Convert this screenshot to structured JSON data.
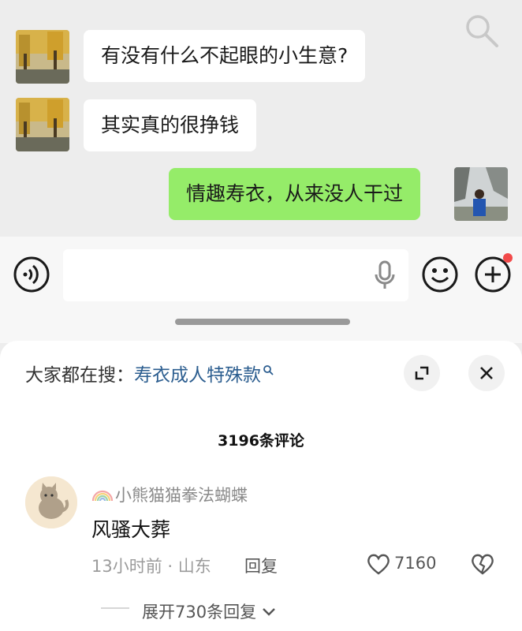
{
  "chat": {
    "messages": [
      {
        "side": "left",
        "text": "有没有什么不起眼的小生意?"
      },
      {
        "side": "left",
        "text": "其实真的很挣钱"
      },
      {
        "side": "right",
        "text": "情趣寿衣，从来没人干过"
      }
    ]
  },
  "icons": {
    "search": "search-icon",
    "voice": "voice-icon",
    "mic": "microphone-icon",
    "emoji": "emoji-icon",
    "plus": "plus-icon",
    "expand": "expand-icon",
    "close": "close-icon",
    "heart": "heart-icon",
    "broken_heart": "broken-heart-icon"
  },
  "colors": {
    "chat_bg": "#ededed",
    "incoming_bubble": "#ffffff",
    "outgoing_bubble": "#95ec69",
    "notification_dot": "#f24a4a",
    "search_keyword": "#2b5d8f"
  },
  "comment_sheet": {
    "trending_prefix": "大家都在搜：",
    "trending_keyword": "寿衣成人特殊款",
    "comment_count_title": "3196条评论",
    "comment": {
      "username": "小熊猫猫拳法蝴蝶",
      "text": "风骚大葬",
      "time_location": "13小时前 · 山东",
      "reply_label": "回复",
      "likes": "7160",
      "expand_replies": "展开730条回复"
    }
  }
}
